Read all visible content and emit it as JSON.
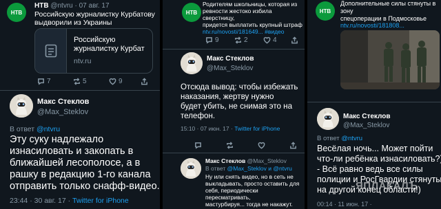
{
  "col1": {
    "author_name": "НТВ",
    "author_handle": "@ntvru",
    "date": "· 07 авг. 17",
    "tweet_lines": [
      "Российскую журналистку Курбатову",
      "выдворили из Украины"
    ],
    "card": {
      "title_lines": [
        "Российскую",
        "журналистку Курбат"
      ],
      "domain": "ntv.ru"
    },
    "actions": {
      "replies": "7",
      "retweets": "5",
      "likes": "9"
    },
    "reply": {
      "name": "Макс Стеклов",
      "handle": "@Max_Steklov",
      "in_reply_prefix": "В ответ",
      "in_reply_to": "@ntvru",
      "text_lines": [
        "Эту суку надлежало",
        "изнасиловать и закопать в",
        "ближайшей лесополосе, а в",
        "рашку в редакцию 1-го канала",
        "отправить только снафф-видео."
      ],
      "time": "23:44 · 30 авг. 17 ·",
      "client": "Twitter for iPhone"
    }
  },
  "col2": {
    "tweet_lines": [
      "Родителям школьницы, которая из",
      "ревности жестоко избила сверстницу,",
      "придется выплатить крупный штраф"
    ],
    "tweet_link": "ntv.ru/novosti/181649...",
    "hashtag": "#видео",
    "actions": {
      "replies": "9",
      "retweets": "2",
      "likes": "4"
    },
    "reply": {
      "name": "Макс Стеклов",
      "handle": "@Max_Steklov",
      "text_lines": [
        "Отсюда вывод: чтобы избежать",
        "наказания, жертву нужно",
        "будет убить, не снимая это на",
        "телефон."
      ],
      "time": "15:10 · 07 июн. 17 ·",
      "client": "Twitter for iPhone"
    },
    "reply2": {
      "name": "Макс Стеклов",
      "handle": "@Max_Steklov",
      "in_reply_prefix": "В ответ",
      "in_reply_to": "@Max_Steklov и @ntvru",
      "text_lines": [
        "Ну или снять видео, но в сеть не",
        "выкладывать, просто оставить для",
        "себя, периодически пересматривать,",
        "мастурбируя... тогда не накажут."
      ]
    }
  },
  "col3": {
    "tweet_lines": [
      "Дополнительные силы стянуты в зону",
      "спецоперации в Подмосковье"
    ],
    "tweet_link": "ntv.ru/novosti/181808...",
    "reply": {
      "name": "Макс Стеклов",
      "handle": "@Max_Steklov",
      "in_reply_prefix": "В ответ",
      "in_reply_to": "@ntvru",
      "text_lines": [
        "Весёлая ночь... Может пойти",
        "что-ли ребёнка изнасиловать?)",
        "- Всё равно ведь все силы",
        "полиции и РосГвардии стянуты",
        "на другой конец области!)"
      ],
      "time": "00:14 · 11 июн. 17 ·"
    },
    "watermark": "ЯПЛАКАЛЪ"
  },
  "colors": {
    "bg": "#10171e",
    "link": "#1da1f2",
    "ntv_green": "#0b9a3c"
  }
}
